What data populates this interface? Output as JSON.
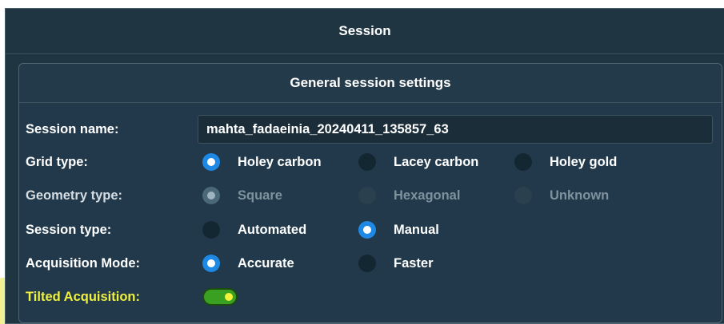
{
  "window": {
    "title": "Session"
  },
  "panel": {
    "title": "General session settings"
  },
  "session_name": {
    "label": "Session name:",
    "value": "mahta_fadaeinia_20240411_135857_63"
  },
  "grid_type": {
    "label": "Grid type:",
    "options": [
      {
        "label": "Holey carbon",
        "selected": true
      },
      {
        "label": "Lacey carbon",
        "selected": false
      },
      {
        "label": "Holey gold",
        "selected": false
      }
    ]
  },
  "geometry_type": {
    "label": "Geometry type:",
    "disabled": true,
    "options": [
      {
        "label": "Square",
        "selected": true
      },
      {
        "label": "Hexagonal",
        "selected": false
      },
      {
        "label": "Unknown",
        "selected": false
      }
    ]
  },
  "session_type": {
    "label": "Session type:",
    "options": [
      {
        "label": "Automated",
        "selected": false
      },
      {
        "label": "Manual",
        "selected": true
      }
    ]
  },
  "acquisition_mode": {
    "label": "Acquisition Mode:",
    "options": [
      {
        "label": "Accurate",
        "selected": true
      },
      {
        "label": "Faster",
        "selected": false
      }
    ]
  },
  "tilted_acquisition": {
    "label": "Tilted Acquisition:",
    "enabled": true
  },
  "colors": {
    "outer_bg": "#1f3542",
    "inner_bg": "#21394a",
    "radio_selected": "#1e88e5",
    "toggle_on": "#3aa022",
    "highlight": "#e6e63c"
  }
}
